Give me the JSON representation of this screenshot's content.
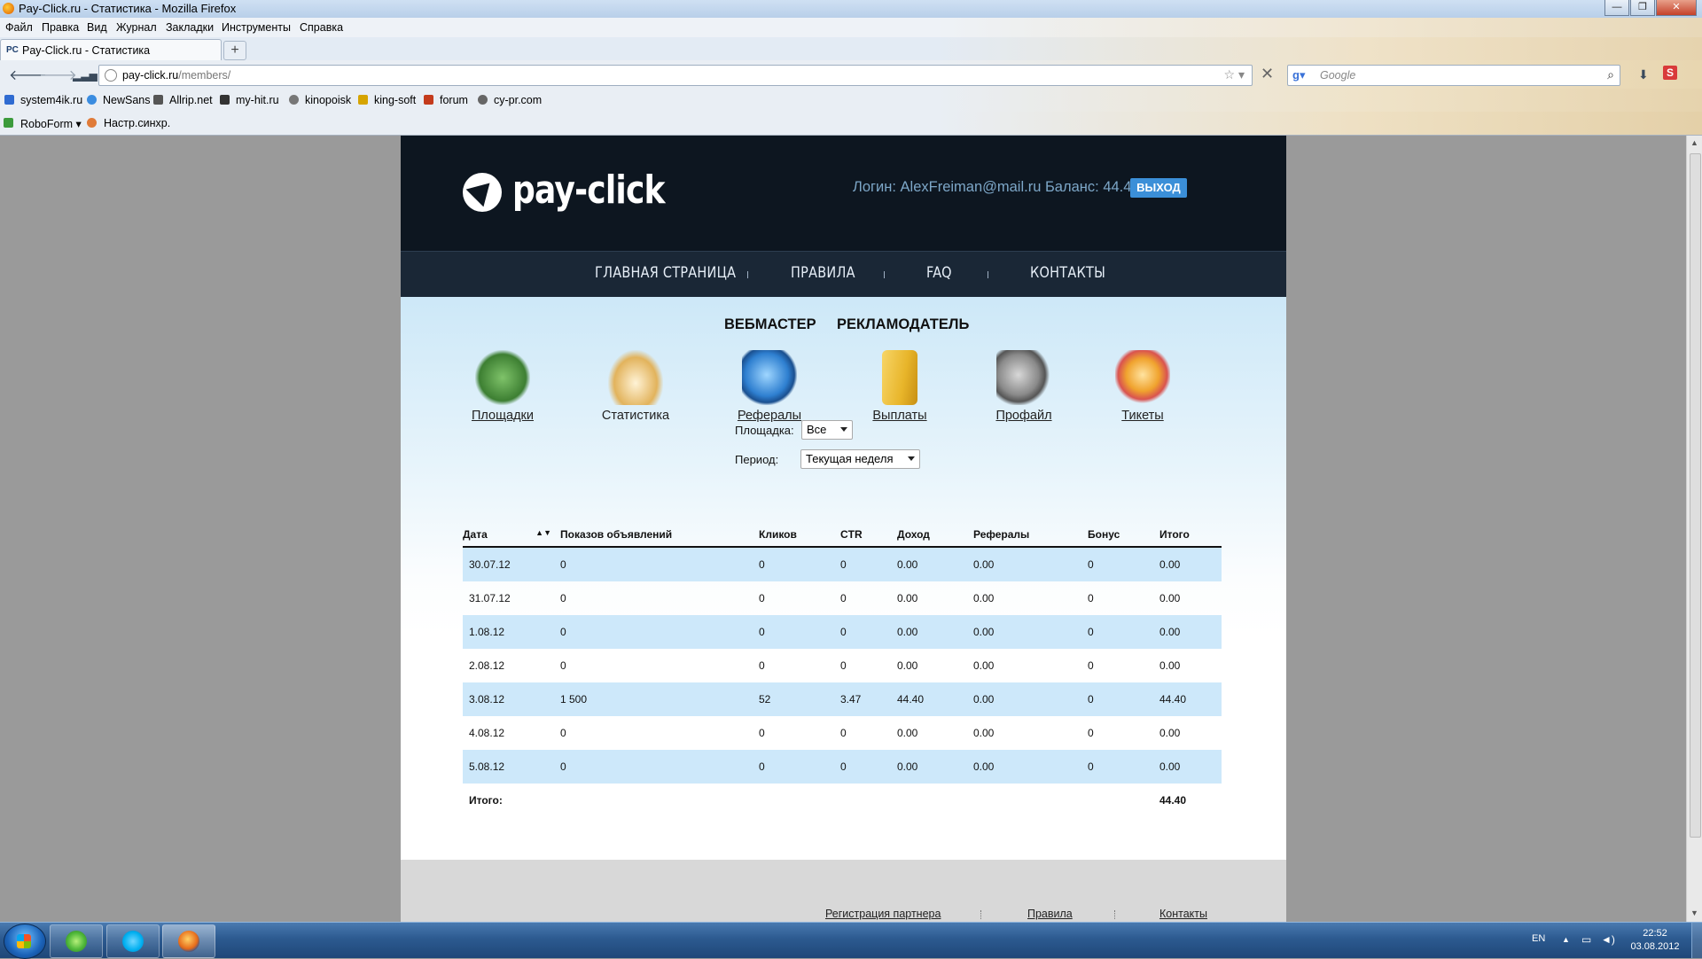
{
  "window": {
    "title": "Pay-Click.ru - Статистика - Mozilla Firefox",
    "buttons": [
      "—",
      "❐",
      "✕"
    ]
  },
  "menubar": [
    "Файл",
    "Правка",
    "Вид",
    "Журнал",
    "Закладки",
    "Инструменты",
    "Справка"
  ],
  "tab": {
    "favicon_text": "PC",
    "label": "Pay-Click.ru - Статистика",
    "new_tab": "+"
  },
  "nav": {
    "back": "🡐",
    "forward": "🡒",
    "url_host": "pay-click.ru",
    "url_path": "/members/",
    "star": "☆ ▾",
    "stop": "✕",
    "search_engine_glyph": "g▾",
    "search_placeholder": "Google",
    "search_button": "⌕",
    "addon_letter": "S"
  },
  "bookmarks": [
    {
      "label": "system4ik.ru",
      "color": "#2f6bd1"
    },
    {
      "label": "NewSans",
      "color": "#3a8ce0"
    },
    {
      "label": "Allrip.net",
      "color": "#555555"
    },
    {
      "label": "my-hit.ru",
      "color": "#333333"
    },
    {
      "label": "kinopoisk",
      "color": "#777777"
    },
    {
      "label": "king-soft",
      "color": "#d6a400"
    },
    {
      "label": "forum",
      "color": "#c43b1c"
    },
    {
      "label": "cy-pr.com",
      "color": "#666666"
    }
  ],
  "toolbar2": {
    "roboform": "RoboForm ▾",
    "sync": "Настр.синхр."
  },
  "site": {
    "logo_text": "pay-click",
    "login_text": "Логин: AlexFreiman@mail.ru Баланс: 44.40",
    "logout": "ВЫХОД",
    "nav": [
      "ГЛАВНАЯ СТРАНИЦА",
      "ПРАВИЛА",
      "FAQ",
      "КОНТАКТЫ"
    ],
    "section_tabs": [
      "ВЕБМАСТЕР",
      "РЕКЛАМОДАТЕЛЬ"
    ],
    "icons": [
      {
        "label": "Площадки",
        "icon": "tools-icon",
        "link": true,
        "color": "#4c8f3a"
      },
      {
        "label": "Статистика",
        "icon": "book-icon",
        "link": false,
        "color": "#e2b35c"
      },
      {
        "label": "Рефералы",
        "icon": "globe-icon",
        "link": true,
        "color": "#2e7fd0"
      },
      {
        "label": "Выплаты",
        "icon": "folder-icon",
        "link": true,
        "color": "#e8b52a"
      },
      {
        "label": "Профайл",
        "icon": "gears-icon",
        "link": true,
        "color": "#8a8a8a"
      },
      {
        "label": "Тикеты",
        "icon": "ticket-icon",
        "link": true,
        "color": "#d9534f"
      }
    ],
    "filters": {
      "platform_label": "Площадка:",
      "platform_value": "Все",
      "period_label": "Период:",
      "period_value": "Текущая неделя"
    },
    "table": {
      "headers": [
        "Дата",
        "Показов объявлений",
        "Кликов",
        "CTR",
        "Доход",
        "Рефералы",
        "Бонус",
        "Итого"
      ],
      "sort_glyph": "▲▼",
      "rows": [
        [
          "30.07.12",
          "0",
          "0",
          "0",
          "0.00",
          "0.00",
          "0",
          "0.00"
        ],
        [
          "31.07.12",
          "0",
          "0",
          "0",
          "0.00",
          "0.00",
          "0",
          "0.00"
        ],
        [
          "1.08.12",
          "0",
          "0",
          "0",
          "0.00",
          "0.00",
          "0",
          "0.00"
        ],
        [
          "2.08.12",
          "0",
          "0",
          "0",
          "0.00",
          "0.00",
          "0",
          "0.00"
        ],
        [
          "3.08.12",
          "1 500",
          "52",
          "3.47",
          "44.40",
          "0.00",
          "0",
          "44.40"
        ],
        [
          "4.08.12",
          "0",
          "0",
          "0",
          "0.00",
          "0.00",
          "0",
          "0.00"
        ],
        [
          "5.08.12",
          "0",
          "0",
          "0",
          "0.00",
          "0.00",
          "0",
          "0.00"
        ]
      ],
      "total_label": "Итого:",
      "total_value": "44.40"
    },
    "footer": [
      "Регистрация партнера",
      "Правила",
      "Контакты"
    ]
  },
  "taskbar": {
    "lang": "EN",
    "tray_arrow": "▲",
    "time": "22:52",
    "date": "03.08.2012",
    "apps": [
      {
        "name": "icq",
        "color": "#4fb83a"
      },
      {
        "name": "skype",
        "color": "#00aff0"
      },
      {
        "name": "firefox",
        "color": "#e66b1a"
      }
    ]
  },
  "scrollbar": {
    "up": "▲",
    "down": "▼"
  }
}
